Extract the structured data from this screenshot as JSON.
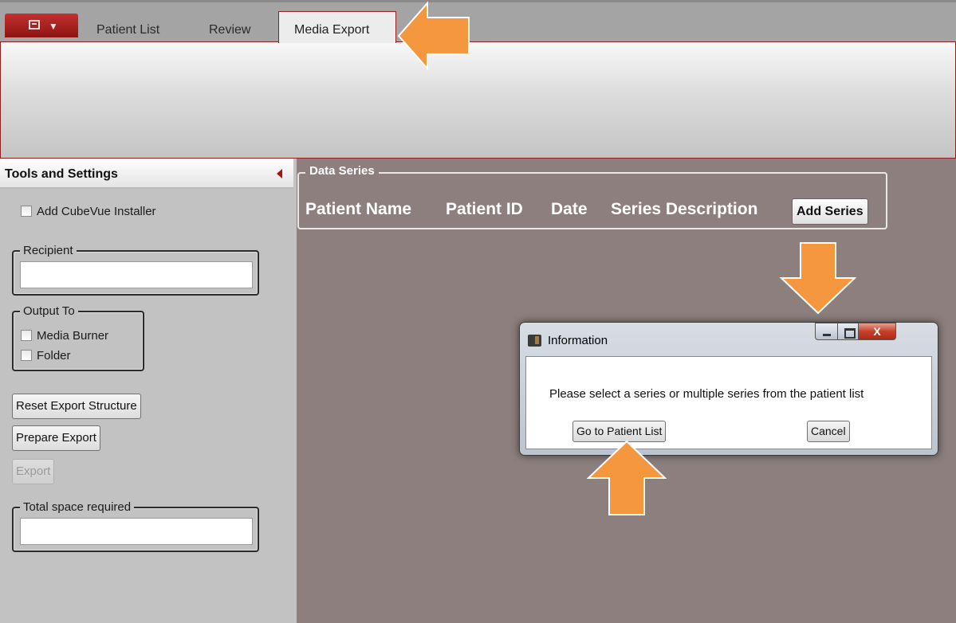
{
  "tabs": {
    "patient_list": "Patient List",
    "review": "Review",
    "media_export": "Media Export"
  },
  "left_panel": {
    "title": "Tools and Settings",
    "add_installer_label": "Add CubeVue Installer",
    "recipient_label": "Recipient",
    "recipient_value": "",
    "output_to_label": "Output To",
    "output_media_burner": "Media Burner",
    "output_folder": "Folder",
    "reset_export_button": "Reset Export Structure",
    "prepare_export_button": "Prepare Export",
    "export_button": "Export",
    "total_space_label": "Total space required",
    "total_space_value": ""
  },
  "data_series": {
    "legend": "Data Series",
    "columns": [
      "Patient Name",
      "Patient ID",
      "Date",
      "Series Description"
    ],
    "add_series_button": "Add Series"
  },
  "dialog": {
    "title": "Information",
    "message": "Please select a series or multiple series from the patient list",
    "go_button": "Go to Patient List",
    "cancel_button": "Cancel",
    "close_glyph": "X"
  },
  "colors": {
    "accent_red": "#b01010",
    "workspace": "#8c7f7d",
    "panel": "#c2c2c2",
    "annotation_orange": "#f5973f"
  },
  "icons": [
    "app-menu-icon",
    "collapse-left-icon",
    "information-icon",
    "minimize-icon",
    "maximize-icon",
    "close-icon"
  ]
}
